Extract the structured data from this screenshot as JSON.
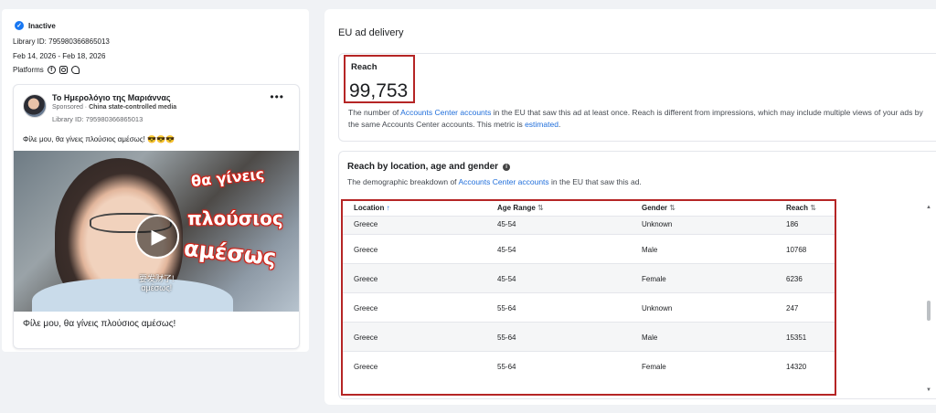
{
  "ad": {
    "status": "Inactive",
    "library_id_line": "Library ID: 795980366865013",
    "date_range": "Feb 14, 2026 - Feb 18, 2026",
    "platforms_label": "Platforms",
    "platform_icons": [
      "facebook-icon",
      "instagram-icon",
      "messenger-icon"
    ],
    "card": {
      "page_name": "Το Ημερολόγιο της Μαριάννας",
      "sponsored": "Sponsored",
      "state_media": "China state-controlled media",
      "library_id": "Library ID: 795980366865013",
      "more": "•••",
      "body_text": "Φίλε μου, θα γίνεις πλούσιος αμέσως! 😎😎😎",
      "overlay_words": [
        "θα γίνεις",
        "πλούσιος",
        "αμέσως"
      ],
      "subtitle_cn_1": "要发财了!",
      "subtitle_cn_2": "αμέσως!",
      "caption": "Φίλε μου, θα γίνεις πλούσιος αμέσως!"
    }
  },
  "delivery": {
    "section_title": "EU ad delivery",
    "reach_label": "Reach",
    "reach_value": "99,753",
    "reach_desc_1": "The number of ",
    "reach_desc_link": "Accounts Center accounts",
    "reach_desc_2": " in the EU that saw this ad at least once. Reach is different from impressions, which may include multiple views of your ads by the same Accounts Center accounts. This metric is ",
    "reach_desc_link2": "estimated",
    "reach_desc_3": "."
  },
  "breakdown": {
    "title": "Reach by location, age and gender",
    "desc_1": "The demographic breakdown of ",
    "desc_link": "Accounts Center accounts",
    "desc_2": " in the EU that saw this ad.",
    "columns": [
      "Location",
      "Age Range",
      "Gender",
      "Reach"
    ],
    "rows": [
      [
        "Greece",
        "45-54",
        "Unknown",
        "186"
      ],
      [
        "Greece",
        "45-54",
        "Male",
        "10768"
      ],
      [
        "Greece",
        "45-54",
        "Female",
        "6236"
      ],
      [
        "Greece",
        "55-64",
        "Unknown",
        "247"
      ],
      [
        "Greece",
        "55-64",
        "Male",
        "15351"
      ],
      [
        "Greece",
        "55-64",
        "Female",
        "14320"
      ]
    ]
  },
  "colors": {
    "accent": "#216fdb",
    "highlight_border": "#b52525",
    "status_badge": "#1877f2"
  }
}
